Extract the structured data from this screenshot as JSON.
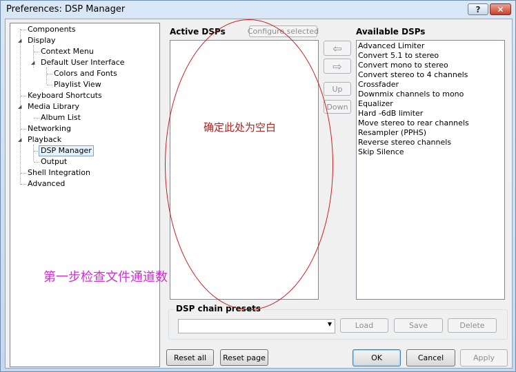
{
  "window": {
    "title": "Preferences: DSP Manager",
    "help_glyph": "?",
    "close_glyph": "✕"
  },
  "tree": {
    "items": [
      {
        "label": "Components"
      },
      {
        "label": "Display"
      },
      {
        "label": "Context Menu"
      },
      {
        "label": "Default User Interface"
      },
      {
        "label": "Colors and Fonts"
      },
      {
        "label": "Playlist View"
      },
      {
        "label": "Keyboard Shortcuts"
      },
      {
        "label": "Media Library"
      },
      {
        "label": "Album List"
      },
      {
        "label": "Networking"
      },
      {
        "label": "Playback"
      },
      {
        "label": "DSP Manager"
      },
      {
        "label": "Output"
      },
      {
        "label": "Shell Integration"
      },
      {
        "label": "Advanced"
      }
    ],
    "expand_glyph": "◢"
  },
  "active": {
    "heading": "Active DSPs",
    "configure_label": "Configure selected"
  },
  "arrows": {
    "left": "⇦",
    "right": "⇨"
  },
  "order": {
    "up_label": "Up",
    "down_label": "Down"
  },
  "available": {
    "heading": "Available DSPs",
    "items": [
      "Advanced Limiter",
      "Convert 5.1 to stereo",
      "Convert mono to stereo",
      "Convert stereo to 4 channels",
      "Crossfader",
      "Downmix channels to mono",
      "Equalizer",
      "Hard -6dB limiter",
      "Move stereo to rear channels",
      "Resampler (PPHS)",
      "Reverse stereo channels",
      "Skip Silence"
    ]
  },
  "presets": {
    "heading": "DSP chain presets",
    "combo_value": "",
    "combo_arrow": "▼",
    "load_label": "Load",
    "save_label": "Save",
    "delete_label": "Delete"
  },
  "footer": {
    "reset_all_label": "Reset all",
    "reset_page_label": "Reset page",
    "ok_label": "OK",
    "cancel_label": "Cancel",
    "apply_label": "Apply"
  },
  "annotations": {
    "red_note": "确定此处为空白",
    "pink_note": "第一步检查文件通道数",
    "red_color": "#b0201c",
    "pink_color": "#cc33cc"
  }
}
